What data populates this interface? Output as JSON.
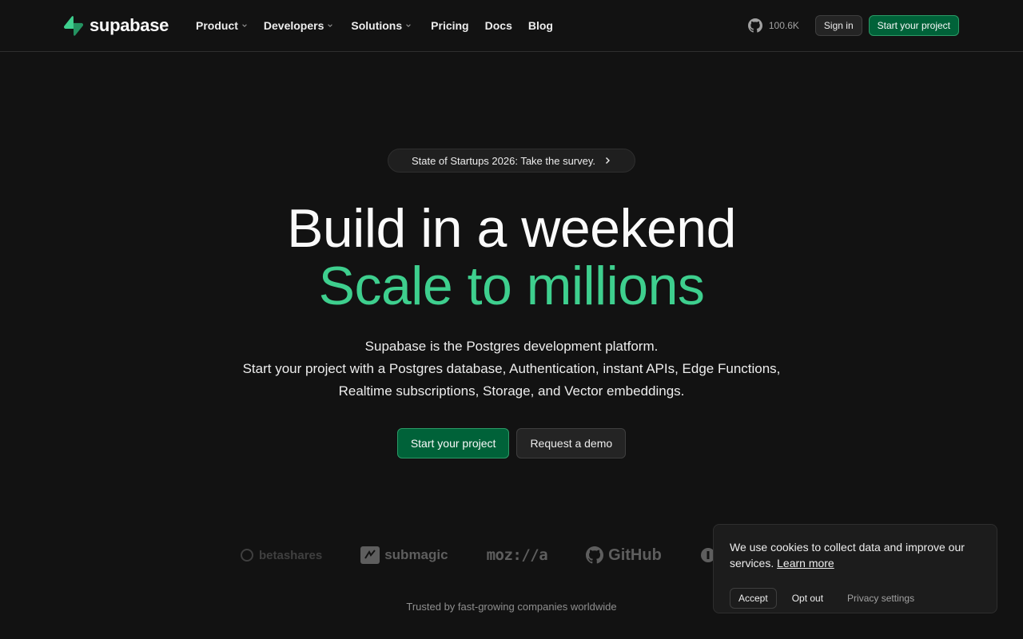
{
  "nav": {
    "brand": "supabase",
    "links": [
      {
        "label": "Product",
        "dropdown": true
      },
      {
        "label": "Developers",
        "dropdown": true
      },
      {
        "label": "Solutions",
        "dropdown": true
      },
      {
        "label": "Pricing",
        "dropdown": false
      },
      {
        "label": "Docs",
        "dropdown": false
      },
      {
        "label": "Blog",
        "dropdown": false
      }
    ],
    "github_stars": "100.6K",
    "sign_in": "Sign in",
    "start_project": "Start your project"
  },
  "hero": {
    "announcement": "State of Startups 2026: Take the survey.",
    "title_line1": "Build in a weekend",
    "title_line2": "Scale to millions",
    "subtitle_line1": "Supabase is the Postgres development platform.",
    "subtitle_line2": "Start your project with a Postgres database, Authentication, instant APIs, Edge Functions, Realtime subscriptions, Storage, and Vector embeddings.",
    "cta_primary": "Start your project",
    "cta_secondary": "Request a demo"
  },
  "logos": {
    "brands": [
      "betashares",
      "submagic",
      "moz://a",
      "GitHub"
    ],
    "caption": "Trusted by fast-growing companies worldwide"
  },
  "cookie": {
    "message": "We use cookies to collect data and improve our services.",
    "learn_more": "Learn more",
    "accept": "Accept",
    "opt_out": "Opt out",
    "privacy_settings": "Privacy settings"
  },
  "colors": {
    "background": "#121212",
    "brand_green": "#3ecf8e",
    "button_green": "#006239"
  }
}
